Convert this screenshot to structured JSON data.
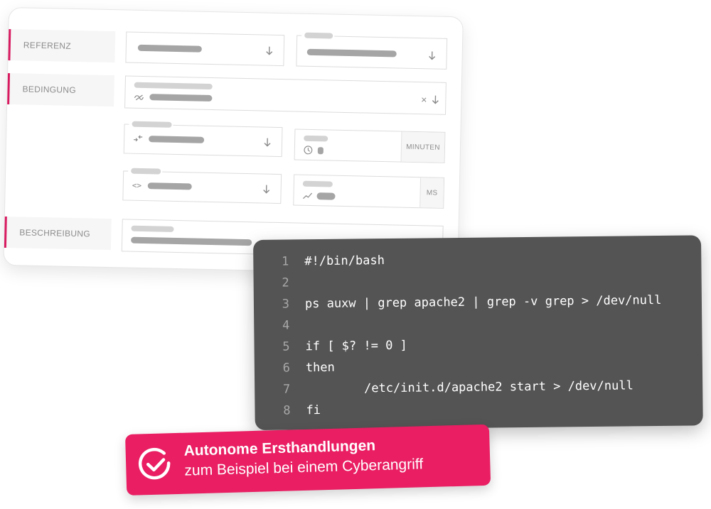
{
  "form": {
    "rows": [
      {
        "label": "REFERENZ"
      },
      {
        "label": "BEDINGUNG"
      },
      {
        "label": "BESCHREIBUNG"
      }
    ],
    "fields": {
      "minutes_suffix": "MINUTEN",
      "ms_suffix": "MS"
    },
    "icons": {
      "select_arrow": "arrow-down-icon",
      "clear": "close-icon",
      "condition": "wave-off-icon",
      "compare": "arrows-compare-icon",
      "code": "code-brackets-icon",
      "clock": "clock-icon",
      "trend": "trend-icon"
    },
    "clear_glyph": "×",
    "code_glyph": "<>"
  },
  "code_panel": {
    "lines": [
      {
        "num": "1",
        "text": "#!/bin/bash"
      },
      {
        "num": "2",
        "text": ""
      },
      {
        "num": "3",
        "text": "ps auxw | grep apache2 | grep -v grep > /dev/null"
      },
      {
        "num": "4",
        "text": ""
      },
      {
        "num": "5",
        "text": "if [ $? != 0 ]"
      },
      {
        "num": "6",
        "text": "then"
      },
      {
        "num": "7",
        "text": "        /etc/init.d/apache2 start > /dev/null"
      },
      {
        "num": "8",
        "text": "fi"
      }
    ]
  },
  "banner": {
    "title": "Autonome Ersthandlungen",
    "subtitle": "zum Beispiel bei einem Cyberangriff",
    "icon": "check-circle-icon"
  },
  "colors": {
    "accent": "#e91e63",
    "label_bar": "#d81b60",
    "code_bg": "#545454"
  }
}
